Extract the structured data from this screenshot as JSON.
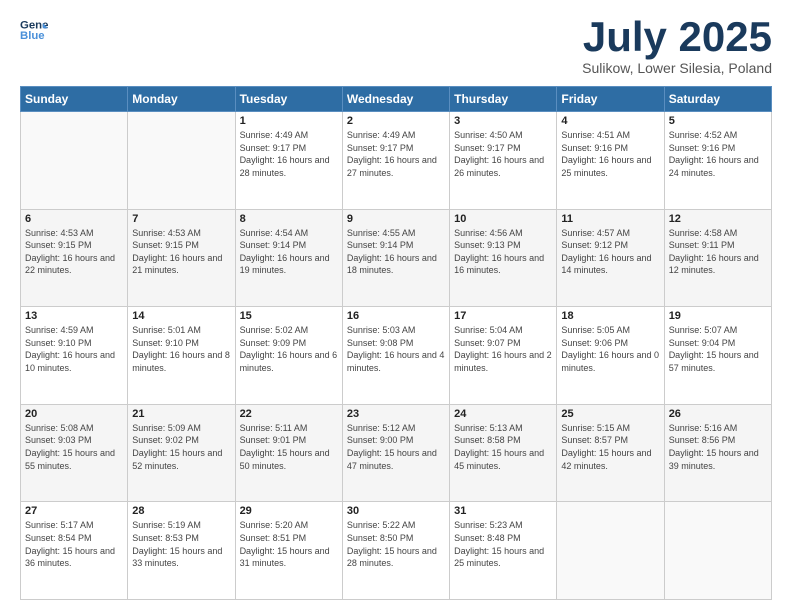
{
  "logo": {
    "line1": "General",
    "line2": "Blue"
  },
  "title": "July 2025",
  "subtitle": "Sulikow, Lower Silesia, Poland",
  "weekdays": [
    "Sunday",
    "Monday",
    "Tuesday",
    "Wednesday",
    "Thursday",
    "Friday",
    "Saturday"
  ],
  "weeks": [
    [
      {
        "day": "",
        "sunrise": "",
        "sunset": "",
        "daylight": ""
      },
      {
        "day": "",
        "sunrise": "",
        "sunset": "",
        "daylight": ""
      },
      {
        "day": "1",
        "sunrise": "Sunrise: 4:49 AM",
        "sunset": "Sunset: 9:17 PM",
        "daylight": "Daylight: 16 hours and 28 minutes."
      },
      {
        "day": "2",
        "sunrise": "Sunrise: 4:49 AM",
        "sunset": "Sunset: 9:17 PM",
        "daylight": "Daylight: 16 hours and 27 minutes."
      },
      {
        "day": "3",
        "sunrise": "Sunrise: 4:50 AM",
        "sunset": "Sunset: 9:17 PM",
        "daylight": "Daylight: 16 hours and 26 minutes."
      },
      {
        "day": "4",
        "sunrise": "Sunrise: 4:51 AM",
        "sunset": "Sunset: 9:16 PM",
        "daylight": "Daylight: 16 hours and 25 minutes."
      },
      {
        "day": "5",
        "sunrise": "Sunrise: 4:52 AM",
        "sunset": "Sunset: 9:16 PM",
        "daylight": "Daylight: 16 hours and 24 minutes."
      }
    ],
    [
      {
        "day": "6",
        "sunrise": "Sunrise: 4:53 AM",
        "sunset": "Sunset: 9:15 PM",
        "daylight": "Daylight: 16 hours and 22 minutes."
      },
      {
        "day": "7",
        "sunrise": "Sunrise: 4:53 AM",
        "sunset": "Sunset: 9:15 PM",
        "daylight": "Daylight: 16 hours and 21 minutes."
      },
      {
        "day": "8",
        "sunrise": "Sunrise: 4:54 AM",
        "sunset": "Sunset: 9:14 PM",
        "daylight": "Daylight: 16 hours and 19 minutes."
      },
      {
        "day": "9",
        "sunrise": "Sunrise: 4:55 AM",
        "sunset": "Sunset: 9:14 PM",
        "daylight": "Daylight: 16 hours and 18 minutes."
      },
      {
        "day": "10",
        "sunrise": "Sunrise: 4:56 AM",
        "sunset": "Sunset: 9:13 PM",
        "daylight": "Daylight: 16 hours and 16 minutes."
      },
      {
        "day": "11",
        "sunrise": "Sunrise: 4:57 AM",
        "sunset": "Sunset: 9:12 PM",
        "daylight": "Daylight: 16 hours and 14 minutes."
      },
      {
        "day": "12",
        "sunrise": "Sunrise: 4:58 AM",
        "sunset": "Sunset: 9:11 PM",
        "daylight": "Daylight: 16 hours and 12 minutes."
      }
    ],
    [
      {
        "day": "13",
        "sunrise": "Sunrise: 4:59 AM",
        "sunset": "Sunset: 9:10 PM",
        "daylight": "Daylight: 16 hours and 10 minutes."
      },
      {
        "day": "14",
        "sunrise": "Sunrise: 5:01 AM",
        "sunset": "Sunset: 9:10 PM",
        "daylight": "Daylight: 16 hours and 8 minutes."
      },
      {
        "day": "15",
        "sunrise": "Sunrise: 5:02 AM",
        "sunset": "Sunset: 9:09 PM",
        "daylight": "Daylight: 16 hours and 6 minutes."
      },
      {
        "day": "16",
        "sunrise": "Sunrise: 5:03 AM",
        "sunset": "Sunset: 9:08 PM",
        "daylight": "Daylight: 16 hours and 4 minutes."
      },
      {
        "day": "17",
        "sunrise": "Sunrise: 5:04 AM",
        "sunset": "Sunset: 9:07 PM",
        "daylight": "Daylight: 16 hours and 2 minutes."
      },
      {
        "day": "18",
        "sunrise": "Sunrise: 5:05 AM",
        "sunset": "Sunset: 9:06 PM",
        "daylight": "Daylight: 16 hours and 0 minutes."
      },
      {
        "day": "19",
        "sunrise": "Sunrise: 5:07 AM",
        "sunset": "Sunset: 9:04 PM",
        "daylight": "Daylight: 15 hours and 57 minutes."
      }
    ],
    [
      {
        "day": "20",
        "sunrise": "Sunrise: 5:08 AM",
        "sunset": "Sunset: 9:03 PM",
        "daylight": "Daylight: 15 hours and 55 minutes."
      },
      {
        "day": "21",
        "sunrise": "Sunrise: 5:09 AM",
        "sunset": "Sunset: 9:02 PM",
        "daylight": "Daylight: 15 hours and 52 minutes."
      },
      {
        "day": "22",
        "sunrise": "Sunrise: 5:11 AM",
        "sunset": "Sunset: 9:01 PM",
        "daylight": "Daylight: 15 hours and 50 minutes."
      },
      {
        "day": "23",
        "sunrise": "Sunrise: 5:12 AM",
        "sunset": "Sunset: 9:00 PM",
        "daylight": "Daylight: 15 hours and 47 minutes."
      },
      {
        "day": "24",
        "sunrise": "Sunrise: 5:13 AM",
        "sunset": "Sunset: 8:58 PM",
        "daylight": "Daylight: 15 hours and 45 minutes."
      },
      {
        "day": "25",
        "sunrise": "Sunrise: 5:15 AM",
        "sunset": "Sunset: 8:57 PM",
        "daylight": "Daylight: 15 hours and 42 minutes."
      },
      {
        "day": "26",
        "sunrise": "Sunrise: 5:16 AM",
        "sunset": "Sunset: 8:56 PM",
        "daylight": "Daylight: 15 hours and 39 minutes."
      }
    ],
    [
      {
        "day": "27",
        "sunrise": "Sunrise: 5:17 AM",
        "sunset": "Sunset: 8:54 PM",
        "daylight": "Daylight: 15 hours and 36 minutes."
      },
      {
        "day": "28",
        "sunrise": "Sunrise: 5:19 AM",
        "sunset": "Sunset: 8:53 PM",
        "daylight": "Daylight: 15 hours and 33 minutes."
      },
      {
        "day": "29",
        "sunrise": "Sunrise: 5:20 AM",
        "sunset": "Sunset: 8:51 PM",
        "daylight": "Daylight: 15 hours and 31 minutes."
      },
      {
        "day": "30",
        "sunrise": "Sunrise: 5:22 AM",
        "sunset": "Sunset: 8:50 PM",
        "daylight": "Daylight: 15 hours and 28 minutes."
      },
      {
        "day": "31",
        "sunrise": "Sunrise: 5:23 AM",
        "sunset": "Sunset: 8:48 PM",
        "daylight": "Daylight: 15 hours and 25 minutes."
      },
      {
        "day": "",
        "sunrise": "",
        "sunset": "",
        "daylight": ""
      },
      {
        "day": "",
        "sunrise": "",
        "sunset": "",
        "daylight": ""
      }
    ]
  ]
}
